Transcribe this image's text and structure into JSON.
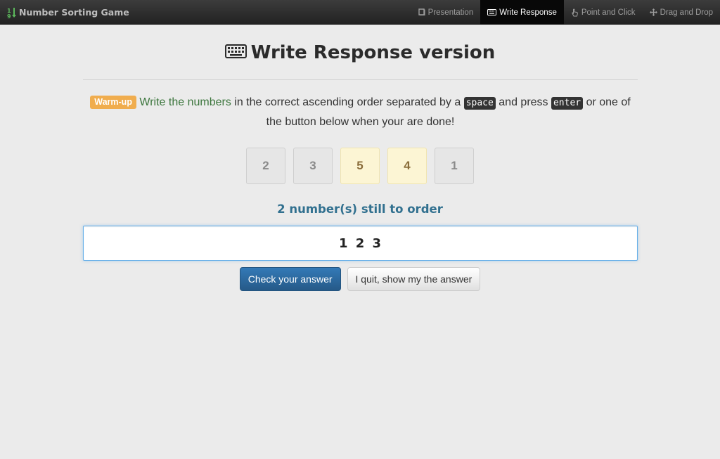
{
  "navbar": {
    "brand": "Number Sorting Game",
    "links": [
      {
        "label": "Presentation",
        "icon": "book-icon",
        "active": false
      },
      {
        "label": "Write Response",
        "icon": "keyboard-icon",
        "active": true
      },
      {
        "label": "Point and Click",
        "icon": "hand-pointer-icon",
        "active": false
      },
      {
        "label": "Drag and Drop",
        "icon": "move-arrows-icon",
        "active": false
      }
    ]
  },
  "main": {
    "title": "Write Response version",
    "instructions": {
      "badge": "Warm-up",
      "lead": "Write the numbers",
      "text1": " in the correct ascending order separated by a ",
      "key_space": "space",
      "text2": " and press ",
      "key_enter": "enter",
      "text3": " or one of the button below when your are done!"
    },
    "tiles": [
      {
        "value": "2",
        "highlighted": false
      },
      {
        "value": "3",
        "highlighted": false
      },
      {
        "value": "5",
        "highlighted": true
      },
      {
        "value": "4",
        "highlighted": true
      },
      {
        "value": "1",
        "highlighted": false
      }
    ],
    "remaining": "2 number(s) still to order",
    "answer_value": "1 2 3",
    "check_button": "Check your answer",
    "quit_button": "I quit, show my the answer"
  },
  "colors": {
    "accent": "#337ab7",
    "badge": "#f0ad4e",
    "info_text": "#31708f",
    "success_text": "#3c763d",
    "highlight_tile": "#fcf5d4"
  }
}
